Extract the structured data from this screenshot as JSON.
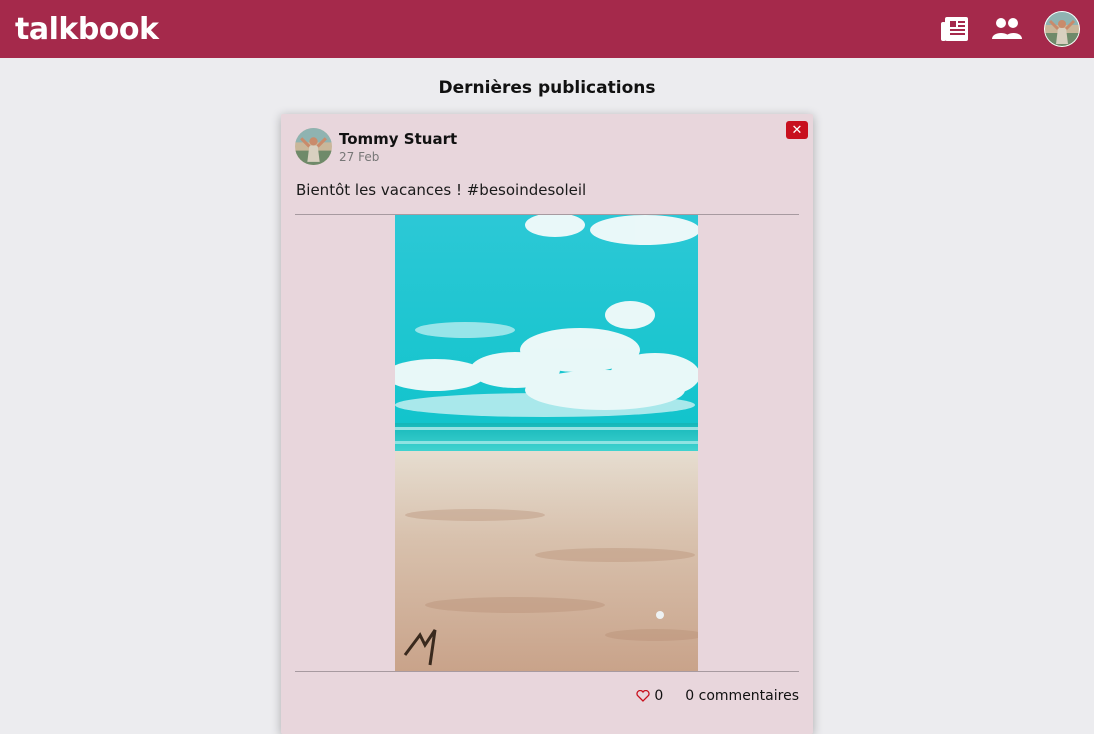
{
  "app": {
    "brand": "talkbook",
    "accent": "#a5294b"
  },
  "nav": {
    "icons": [
      "newspaper-icon",
      "users-icon",
      "profile-avatar"
    ]
  },
  "feed": {
    "title": "Dernières publications"
  },
  "post": {
    "author": "Tommy Stuart",
    "date": "27 Feb",
    "text": "Bientôt les vacances ! #besoindesoleil",
    "delete_label": "✕",
    "likes": "0",
    "comments": "0 commentaires",
    "image": "beach-photo"
  }
}
